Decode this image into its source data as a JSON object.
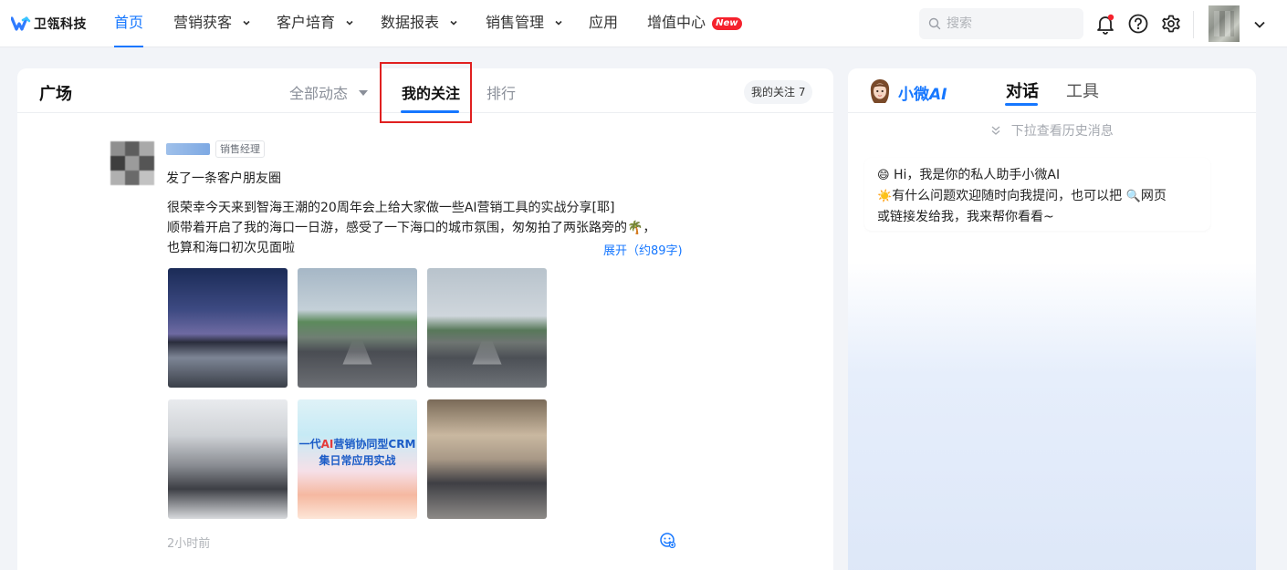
{
  "brand": {
    "name": "卫瓴科技"
  },
  "nav": {
    "items": [
      {
        "label": "首页",
        "active": true,
        "dropdown": false
      },
      {
        "label": "营销获客",
        "dropdown": true
      },
      {
        "label": "客户培育",
        "dropdown": true
      },
      {
        "label": "数据报表",
        "dropdown": true
      },
      {
        "label": "销售管理",
        "dropdown": true
      },
      {
        "label": "应用",
        "dropdown": false
      },
      {
        "label": "增值中心",
        "badge": "New",
        "dropdown": false
      }
    ],
    "search_placeholder": "搜索"
  },
  "plaza": {
    "title": "广场",
    "tabs": {
      "all": "全部动态",
      "following": "我的关注",
      "rank": "排行"
    },
    "follow_count_label": "我的关注 7"
  },
  "post": {
    "role": "销售经理",
    "action": "发了一条客户朋友圈",
    "body_lines": [
      "很荣幸今天来到智海王潮的20周年会上给大家做一些AI营销工具的实战分享[耶]",
      "顺带着开启了我的海口一日游，感受了一下海口的城市氛围，匆匆拍了两张路旁的🌴，",
      "也算和海口初次见面啦"
    ],
    "expand": "展开（约89字)",
    "photo5_text": {
      "line1a": "一代",
      "line1b": "AI",
      "line1c": "营销协同型CRM",
      "line2": "集日常应用实战"
    },
    "time": "2小时前"
  },
  "assistant": {
    "name": "小微",
    "name_suffix": "AI",
    "tabs": {
      "chat": "对话",
      "tools": "工具"
    },
    "history_hint": "下拉查看历史消息",
    "greeting_line1": "Hi，我是你的私人助手小微AI",
    "greeting_line2a": "有什么问题欢迎随时向我提问，也可以把",
    "greeting_line2b": "网页",
    "greeting_line3": "或链接发给我，我来帮你看看~"
  },
  "colors": {
    "accent": "#1677ff",
    "highlight": "#e02020",
    "badge": "#f5222d"
  }
}
